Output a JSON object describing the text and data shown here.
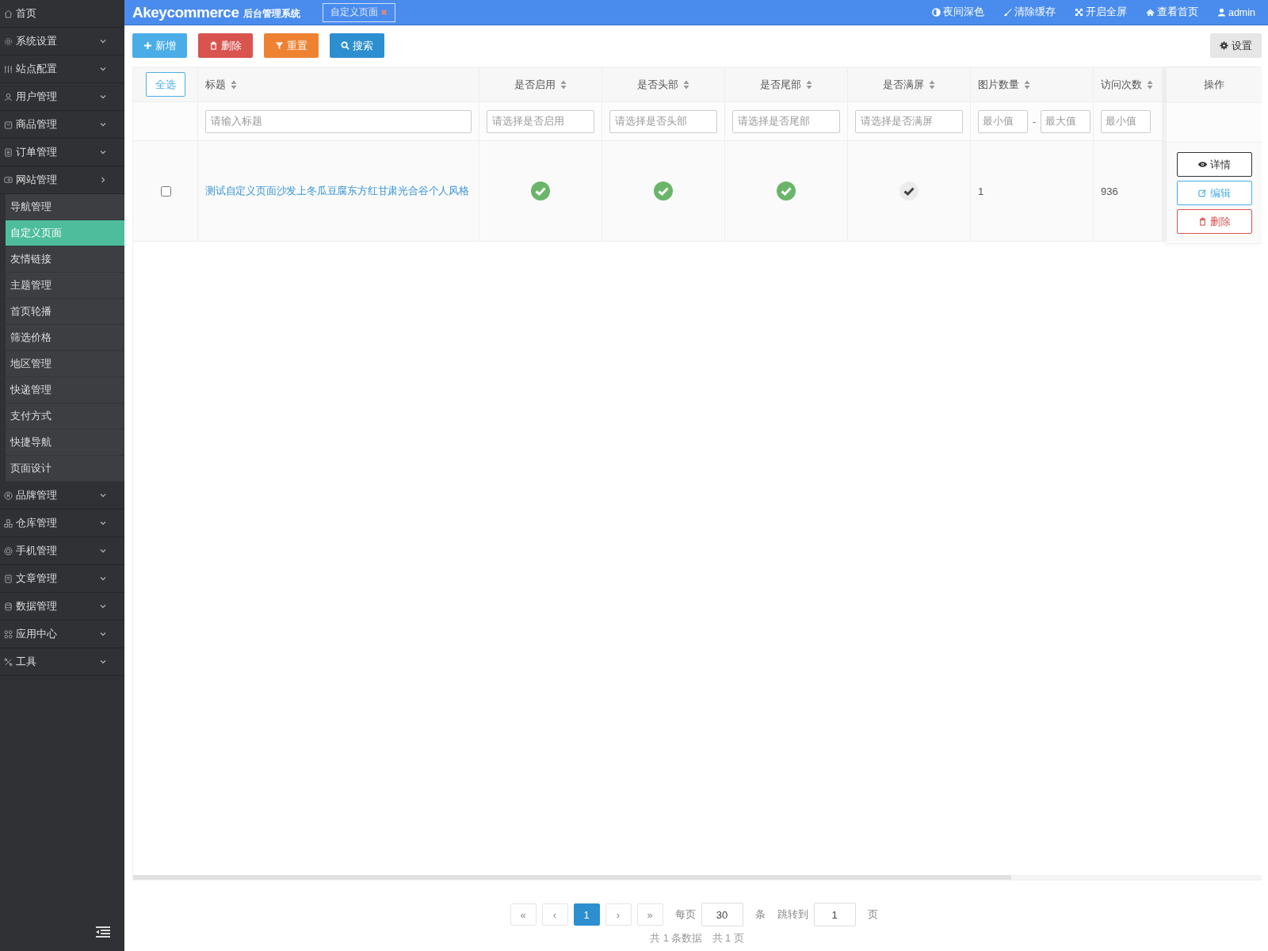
{
  "sidebar": {
    "items": [
      {
        "label": "首页",
        "kind": "link"
      },
      {
        "label": "系统设置",
        "kind": "menu",
        "expanded": false
      },
      {
        "label": "站点配置",
        "kind": "menu",
        "expanded": false
      },
      {
        "label": "用户管理",
        "kind": "menu",
        "expanded": false
      },
      {
        "label": "商品管理",
        "kind": "menu",
        "expanded": false
      },
      {
        "label": "订单管理",
        "kind": "menu",
        "expanded": false
      },
      {
        "label": "网站管理",
        "kind": "menu",
        "expanded": true,
        "children": [
          {
            "label": "导航管理",
            "selected": false
          },
          {
            "label": "自定义页面",
            "selected": true
          },
          {
            "label": "友情链接",
            "selected": false
          },
          {
            "label": "主题管理",
            "selected": false
          },
          {
            "label": "首页轮播",
            "selected": false
          },
          {
            "label": "筛选价格",
            "selected": false
          },
          {
            "label": "地区管理",
            "selected": false
          },
          {
            "label": "快递管理",
            "selected": false
          },
          {
            "label": "支付方式",
            "selected": false
          },
          {
            "label": "快捷导航",
            "selected": false
          },
          {
            "label": "页面设计",
            "selected": false
          }
        ]
      },
      {
        "label": "品牌管理",
        "kind": "menu",
        "expanded": false
      },
      {
        "label": "仓库管理",
        "kind": "menu",
        "expanded": false
      },
      {
        "label": "手机管理",
        "kind": "menu",
        "expanded": false
      },
      {
        "label": "文章管理",
        "kind": "menu",
        "expanded": false
      },
      {
        "label": "数据管理",
        "kind": "menu",
        "expanded": false
      },
      {
        "label": "应用中心",
        "kind": "menu",
        "expanded": false
      },
      {
        "label": "工具",
        "kind": "menu",
        "expanded": false
      }
    ]
  },
  "header": {
    "logo": "Akeycommerce",
    "subtitle": "后台管理系统",
    "tabs": [
      {
        "label": "自定义页面"
      }
    ],
    "links": [
      {
        "label": "夜间深色"
      },
      {
        "label": "清除缓存"
      },
      {
        "label": "开启全屏"
      },
      {
        "label": "查看首页"
      },
      {
        "label": "admin"
      }
    ]
  },
  "toolbar": {
    "buttons": [
      {
        "label": "新增",
        "kind": "add"
      },
      {
        "label": "删除",
        "kind": "delete"
      },
      {
        "label": "重置",
        "kind": "reset"
      },
      {
        "label": "搜索",
        "kind": "search"
      }
    ],
    "settings": "设置"
  },
  "table": {
    "select_all": "全选",
    "columns": [
      {
        "label": "标题"
      },
      {
        "label": "是否启用"
      },
      {
        "label": "是否头部"
      },
      {
        "label": "是否尾部"
      },
      {
        "label": "是否满屏"
      },
      {
        "label": "图片数量"
      },
      {
        "label": "访问次数"
      }
    ],
    "action_column": "操作",
    "filters": [
      {
        "kind": "text",
        "placeholder": "请输入标题"
      },
      {
        "kind": "select",
        "placeholder": "请选择是否启用"
      },
      {
        "kind": "select",
        "placeholder": "请选择是否头部"
      },
      {
        "kind": "select",
        "placeholder": "请选择是否尾部"
      },
      {
        "kind": "select",
        "placeholder": "请选择是否满屏"
      },
      {
        "kind": "range",
        "placeholder": "最小值",
        "placeholder_max": "最大值",
        "separator": "-"
      },
      {
        "kind": "min",
        "placeholder": "最小值"
      }
    ],
    "rows": [
      {
        "checked": false,
        "cells": [
          {
            "kind": "link",
            "text": "测试自定义页面沙发上冬瓜豆腐东方红甘肃光合谷个人风格"
          },
          {
            "kind": "bool",
            "on": true
          },
          {
            "kind": "bool",
            "on": true
          },
          {
            "kind": "bool",
            "on": true
          },
          {
            "kind": "bool",
            "on": false
          },
          {
            "kind": "text",
            "text": "1"
          },
          {
            "kind": "text",
            "text": "936"
          }
        ],
        "actions": [
          {
            "label": "详情",
            "kind": "detail"
          },
          {
            "label": "编辑",
            "kind": "edit"
          },
          {
            "label": "删除",
            "kind": "delete"
          }
        ]
      }
    ]
  },
  "pagination": {
    "first": "«",
    "prev": "‹",
    "pages": [
      {
        "label": "1",
        "selected": true
      }
    ],
    "next": "›",
    "last": "»",
    "per_page_label": "每页",
    "per_page": "30",
    "per_page_unit": "条",
    "jump_label": "跳转到",
    "jump_value": "1",
    "jump_unit": "页",
    "total_records": "共 1 条数据",
    "total_pages": "共 1 页"
  }
}
